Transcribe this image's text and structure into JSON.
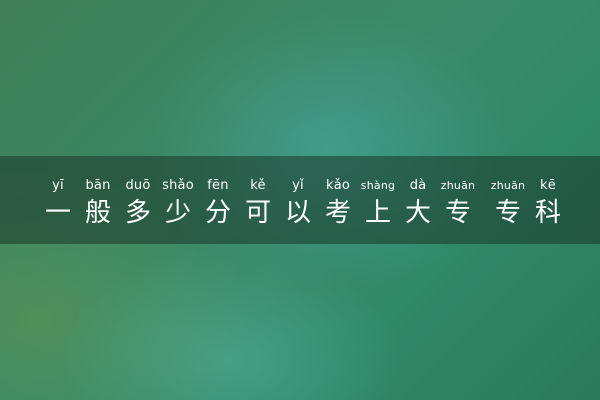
{
  "title": {
    "chars": [
      {
        "pinyin": "yī",
        "hanzi": "一"
      },
      {
        "pinyin": "bān",
        "hanzi": "般"
      },
      {
        "pinyin": "duō",
        "hanzi": "多"
      },
      {
        "pinyin": "shǎo",
        "hanzi": "少"
      },
      {
        "pinyin": "fēn",
        "hanzi": "分"
      },
      {
        "pinyin": "kě",
        "hanzi": "可"
      },
      {
        "pinyin": "yǐ",
        "hanzi": "以"
      },
      {
        "pinyin": "kǎo",
        "hanzi": "考"
      },
      {
        "pinyin": "shàng",
        "hanzi": "上"
      },
      {
        "pinyin": "dà",
        "hanzi": "大"
      },
      {
        "pinyin": "zhuān",
        "hanzi": "专"
      },
      {
        "pinyin": "zhuān",
        "hanzi": "专"
      },
      {
        "pinyin": "kē",
        "hanzi": "科"
      }
    ]
  },
  "colors": {
    "text": "#ffffff",
    "band": "#1c372a",
    "background": "#3a8a6a"
  }
}
